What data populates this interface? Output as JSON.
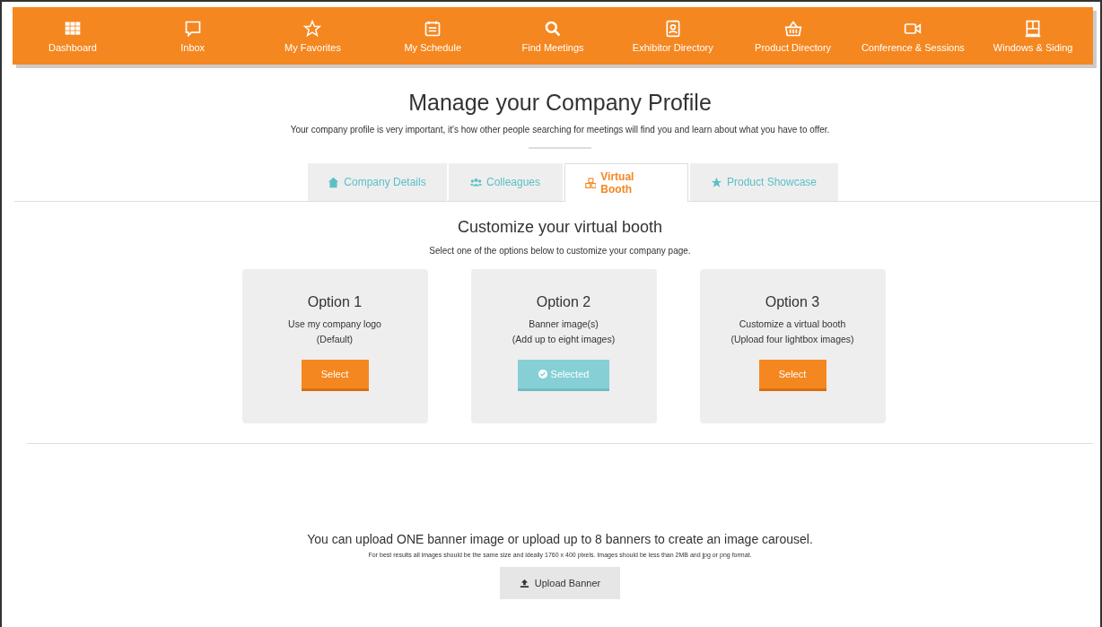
{
  "nav": [
    {
      "label": "Dashboard",
      "kind": "grid"
    },
    {
      "label": "Inbox",
      "kind": "chat"
    },
    {
      "label": "My Favorites",
      "kind": "star"
    },
    {
      "label": "My Schedule",
      "kind": "calendar"
    },
    {
      "label": "Find Meetings",
      "kind": "search"
    },
    {
      "label": "Exhibitor Directory",
      "kind": "contact"
    },
    {
      "label": "Product Directory",
      "kind": "basket"
    },
    {
      "label": "Conference & Sessions",
      "kind": "video"
    },
    {
      "label": "Windows & Siding",
      "kind": "window"
    }
  ],
  "header": {
    "title": "Manage your Company Profile",
    "subtitle": "Your company profile is very important, it's how other people searching for meetings will find you and learn about what you have to offer."
  },
  "tabs": [
    {
      "label": "Company Details",
      "kind": "house",
      "selected": false
    },
    {
      "label": "Colleagues",
      "kind": "people",
      "selected": false
    },
    {
      "label": "Virtual Booth",
      "kind": "booth",
      "selected": true
    },
    {
      "label": "Product Showcase",
      "kind": "star",
      "selected": false
    }
  ],
  "section": {
    "title": "Customize your virtual booth",
    "subtitle": "Select one of the options below to customize your company page."
  },
  "options": [
    {
      "title": "Option 1",
      "lines": [
        "Use my company logo",
        "(Default)"
      ],
      "button": "Select",
      "selected": false
    },
    {
      "title": "Option 2",
      "lines": [
        "Banner image(s)",
        "(Add up to eight images)"
      ],
      "button": "Selected",
      "selected": true
    },
    {
      "title": "Option 3",
      "lines": [
        "Customize a virtual booth",
        "(Upload four lightbox images)"
      ],
      "button": "Select",
      "selected": false
    }
  ],
  "upload": {
    "text": "You can upload ONE banner image or upload up to 8 banners to create an image carousel.",
    "note": "For best results all images should be the same size and ideally 1760 x 400 pixels. Images should be less than 2MB and jpg or png format.",
    "button": "Upload Banner"
  }
}
